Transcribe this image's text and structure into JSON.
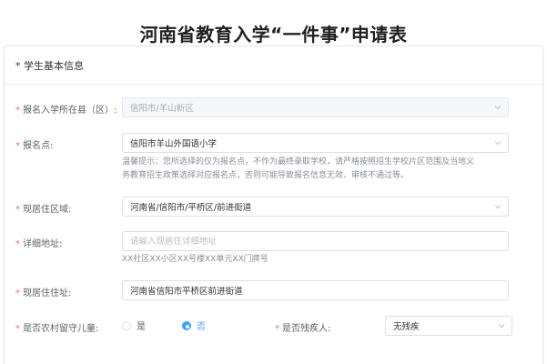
{
  "page": {
    "title": "河南省教育入学“一件事”申请表"
  },
  "section": {
    "title": "* 学生基本信息"
  },
  "form": {
    "county": {
      "label": "报名入学所在县（区）:",
      "value": "信阳市/羊山新区"
    },
    "school": {
      "label": "报名点:",
      "value": "信阳市羊山外国语小学",
      "hint_line1": "温馨提示：您所选择的仅为报名点，不作为最终录取学校，请严格按照招生学校片区范围及当地义",
      "hint_line2": "务教育招生政策选择对应报名点，否则可能导致报名信息无效、审核不通过等。"
    },
    "residence_area": {
      "label": "现居住区域:",
      "value": "河南省/信阳市/平桥区/前进街道"
    },
    "detail_address": {
      "label": "详细地址:",
      "placeholder": "请输入现居住详细地址",
      "hint": "XX社区XX小区XX号楼XX单元XX门牌号"
    },
    "current_address": {
      "label": "现居住住址:",
      "value": "河南省信阳市平桥区前进街道"
    },
    "left_behind": {
      "label": "是否农村留守儿童:",
      "option_yes": "是",
      "option_no": "否",
      "selected": "否"
    },
    "disabled": {
      "label": "是否残疾人:",
      "value": "无残疾"
    }
  },
  "colors": {
    "required": "#f56c6c",
    "accent": "#409eff"
  }
}
